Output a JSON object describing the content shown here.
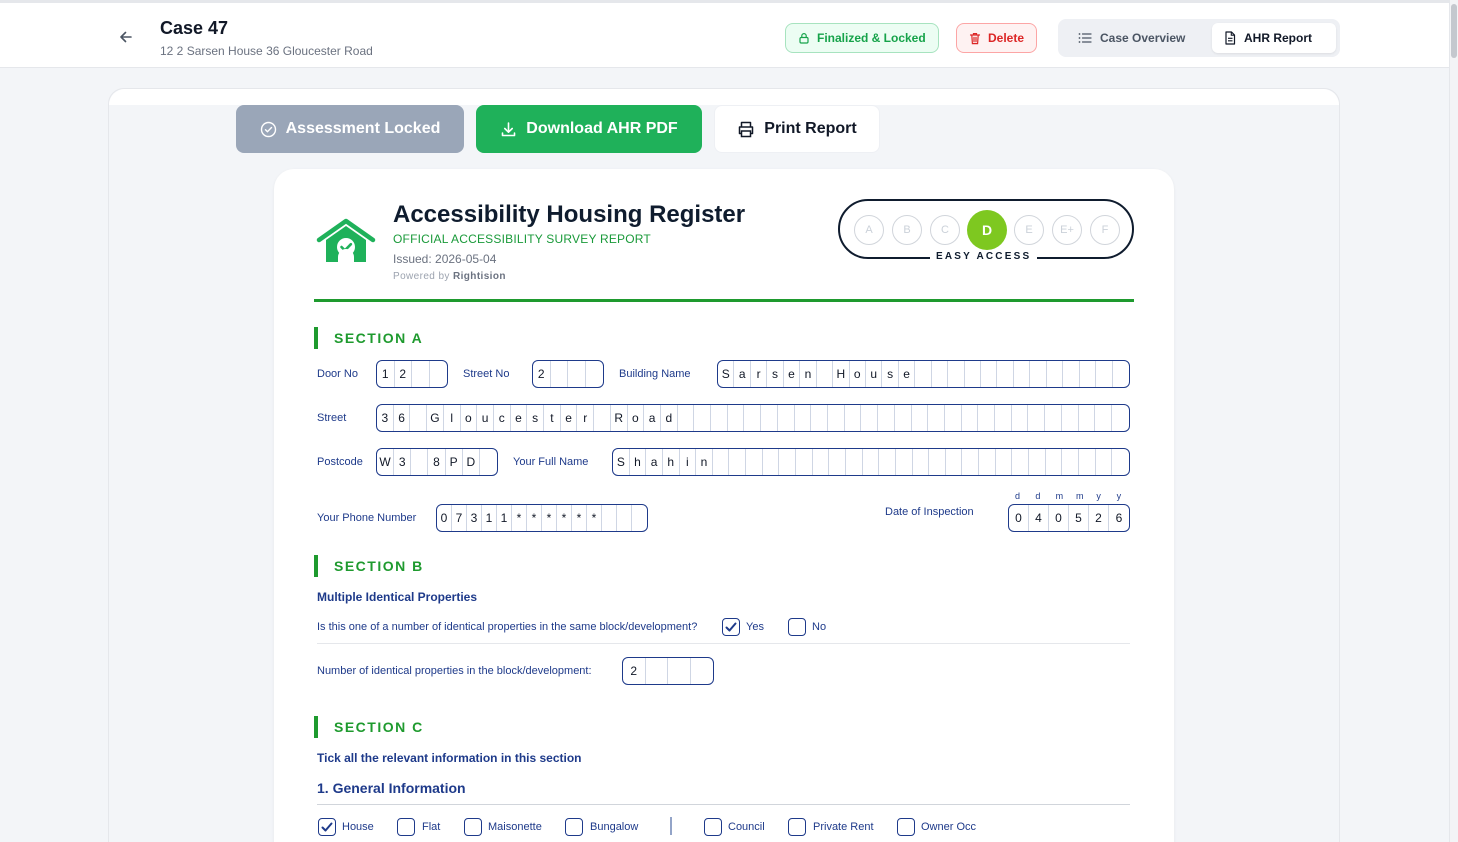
{
  "header": {
    "case_title": "Case 47",
    "case_address": "12 2 Sarsen House 36 Gloucester Road",
    "status_pill": "Finalized & Locked",
    "delete_label": "Delete",
    "tabs": {
      "overview": "Case Overview",
      "ahr": "AHR Report"
    },
    "active_tab": "AHR Report"
  },
  "actions": {
    "assessment_locked": "Assessment Locked",
    "download": "Download AHR PDF",
    "print": "Print Report"
  },
  "report": {
    "title": "Accessibility Housing Register",
    "subtitle": "OFFICIAL ACCESSIBILITY SURVEY REPORT",
    "issued": "Issued: 2026-05-04",
    "powered_prefix": "Powered by",
    "powered_brand": "Rightision",
    "grades": [
      "A",
      "B",
      "C",
      "D",
      "E",
      "E+",
      "F"
    ],
    "active_grade": "D",
    "grade_label": "EASY ACCESS",
    "colors": {
      "brand_green": "#1e9a2e",
      "grade_active": "#7ec820",
      "form_blue": "#1e3a8a"
    }
  },
  "section_a": {
    "title": "SECTION A",
    "door_no": {
      "label": "Door No",
      "value": "12"
    },
    "street_no": {
      "label": "Street No",
      "value": "2"
    },
    "building_name": {
      "label": "Building Name",
      "value": "Sarsen House"
    },
    "street": {
      "label": "Street",
      "value": "36 Gloucester Road"
    },
    "postcode": {
      "label": "Postcode",
      "value": "W3 8PD"
    },
    "full_name": {
      "label": "Your Full Name",
      "value": "Shahin"
    },
    "phone": {
      "label": "Your Phone Number",
      "value": "07311******"
    },
    "inspection_date": {
      "label": "Date of Inspection",
      "headers": [
        "d",
        "d",
        "m",
        "m",
        "y",
        "y"
      ],
      "value": "040526"
    }
  },
  "section_b": {
    "title": "SECTION B",
    "subtitle": "Multiple Identical Properties",
    "question": "Is this one of a number of identical properties in the same block/development?",
    "yes_label": "Yes",
    "yes_checked": true,
    "no_label": "No",
    "no_checked": false,
    "count_label": "Number of identical properties in the block/development:",
    "count_value": "2"
  },
  "section_c": {
    "title": "SECTION C",
    "instruction": "Tick all the relevant information in this section",
    "general_title": "1. General Information",
    "property_types": [
      {
        "label": "House",
        "checked": true
      },
      {
        "label": "Flat",
        "checked": false
      },
      {
        "label": "Maisonette",
        "checked": false
      },
      {
        "label": "Bungalow",
        "checked": false
      }
    ],
    "tenures": [
      {
        "label": "Council",
        "checked": false
      },
      {
        "label": "Private Rent",
        "checked": false
      },
      {
        "label": "Owner Occ",
        "checked": false
      }
    ]
  }
}
